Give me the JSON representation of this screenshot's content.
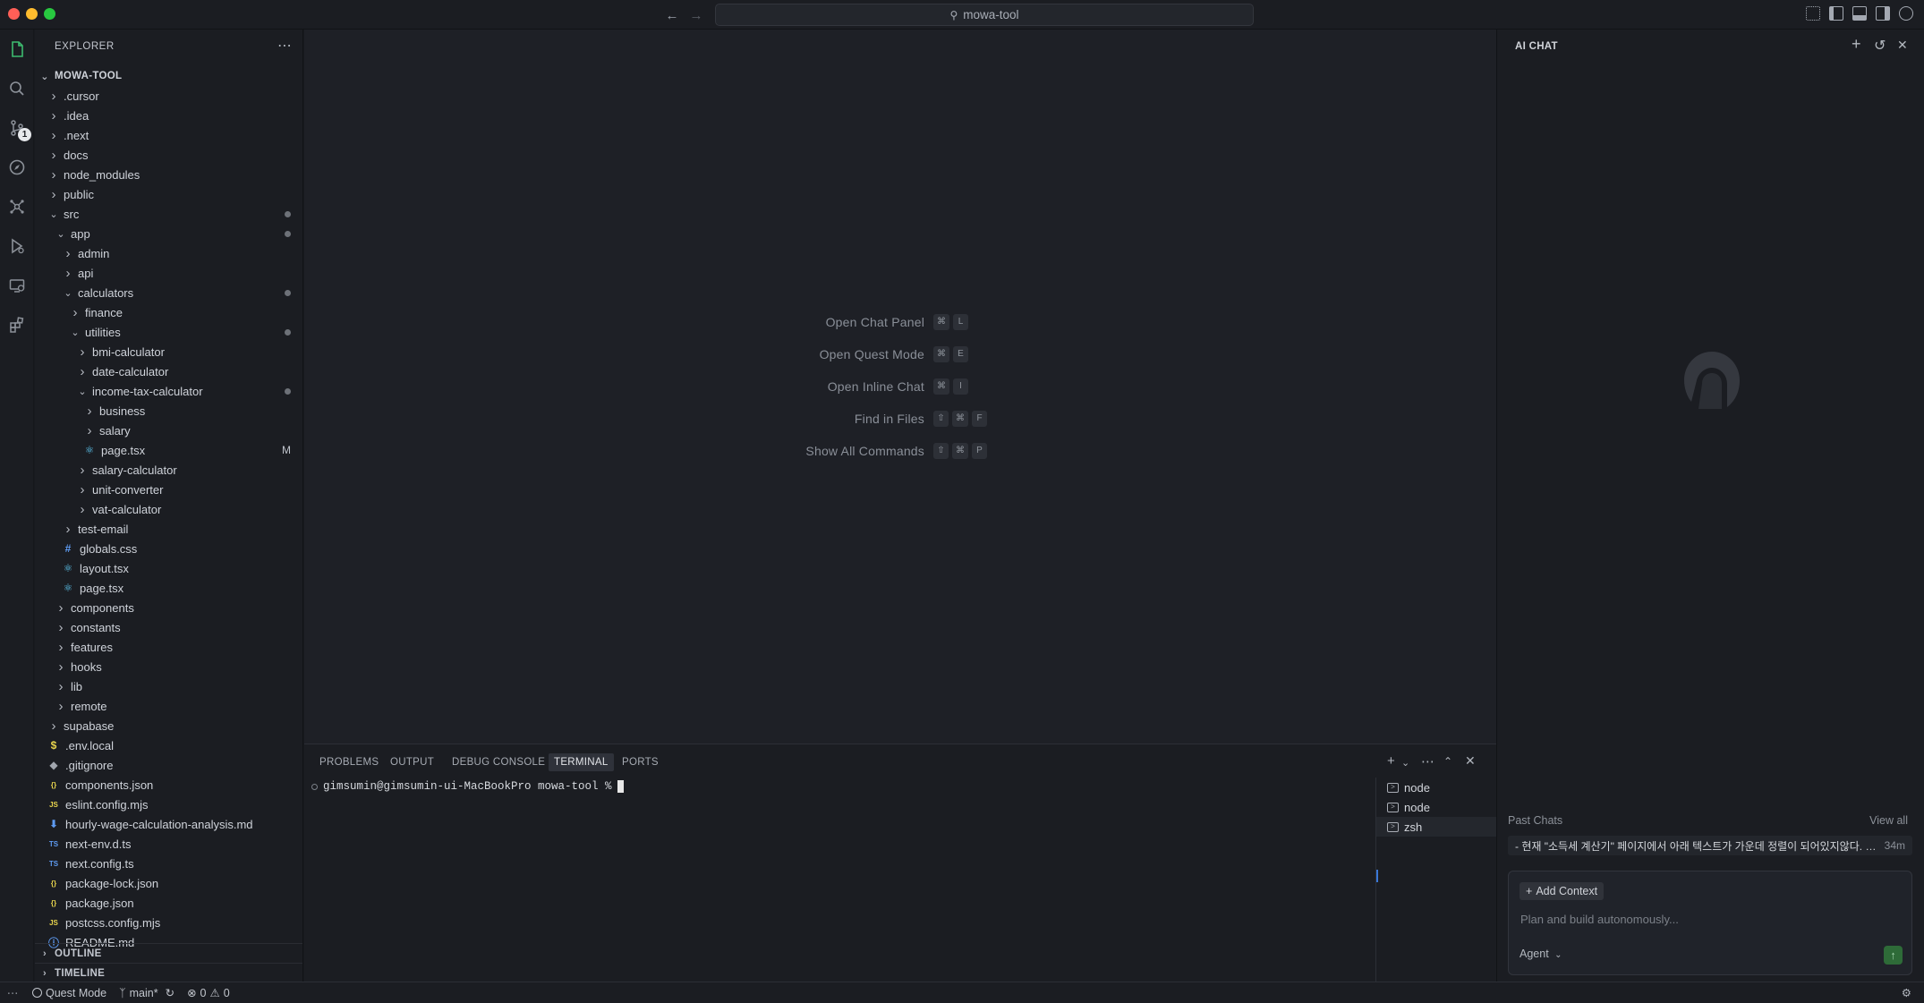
{
  "window": {
    "search_text": "mowa-tool"
  },
  "activity_bar": {
    "scm_badge": "1"
  },
  "explorer": {
    "title": "EXPLORER",
    "root": "MOWA-TOOL",
    "items": [
      {
        "label": ".cursor",
        "depth": 0,
        "type": "folder",
        "open": false
      },
      {
        "label": ".idea",
        "depth": 0,
        "type": "folder",
        "open": false
      },
      {
        "label": ".next",
        "depth": 0,
        "type": "folder",
        "open": false
      },
      {
        "label": "docs",
        "depth": 0,
        "type": "folder",
        "open": false
      },
      {
        "label": "node_modules",
        "depth": 0,
        "type": "folder",
        "open": false
      },
      {
        "label": "public",
        "depth": 0,
        "type": "folder",
        "open": false
      },
      {
        "label": "src",
        "depth": 0,
        "type": "folder",
        "open": true,
        "dot": true
      },
      {
        "label": "app",
        "depth": 1,
        "type": "folder",
        "open": true,
        "dot": true
      },
      {
        "label": "admin",
        "depth": 2,
        "type": "folder",
        "open": false
      },
      {
        "label": "api",
        "depth": 2,
        "type": "folder",
        "open": false
      },
      {
        "label": "calculators",
        "depth": 2,
        "type": "folder",
        "open": true,
        "dot": true
      },
      {
        "label": "finance",
        "depth": 3,
        "type": "folder",
        "open": false
      },
      {
        "label": "utilities",
        "depth": 3,
        "type": "folder",
        "open": true,
        "dot": true
      },
      {
        "label": "bmi-calculator",
        "depth": 4,
        "type": "folder",
        "open": false
      },
      {
        "label": "date-calculator",
        "depth": 4,
        "type": "folder",
        "open": false
      },
      {
        "label": "income-tax-calculator",
        "depth": 4,
        "type": "folder",
        "open": true,
        "dot": true
      },
      {
        "label": "business",
        "depth": 5,
        "type": "folder",
        "open": false
      },
      {
        "label": "salary",
        "depth": 5,
        "type": "folder",
        "open": false
      },
      {
        "label": "page.tsx",
        "depth": 5,
        "type": "react",
        "mark": "M"
      },
      {
        "label": "salary-calculator",
        "depth": 4,
        "type": "folder",
        "open": false
      },
      {
        "label": "unit-converter",
        "depth": 4,
        "type": "folder",
        "open": false
      },
      {
        "label": "vat-calculator",
        "depth": 4,
        "type": "folder",
        "open": false
      },
      {
        "label": "test-email",
        "depth": 2,
        "type": "folder",
        "open": false
      },
      {
        "label": "globals.css",
        "depth": 2,
        "type": "css"
      },
      {
        "label": "layout.tsx",
        "depth": 2,
        "type": "react"
      },
      {
        "label": "page.tsx",
        "depth": 2,
        "type": "react"
      },
      {
        "label": "components",
        "depth": 1,
        "type": "folder",
        "open": false
      },
      {
        "label": "constants",
        "depth": 1,
        "type": "folder",
        "open": false
      },
      {
        "label": "features",
        "depth": 1,
        "type": "folder",
        "open": false
      },
      {
        "label": "hooks",
        "depth": 1,
        "type": "folder",
        "open": false
      },
      {
        "label": "lib",
        "depth": 1,
        "type": "folder",
        "open": false
      },
      {
        "label": "remote",
        "depth": 1,
        "type": "folder",
        "open": false
      },
      {
        "label": "supabase",
        "depth": 0,
        "type": "folder",
        "open": false
      },
      {
        "label": ".env.local",
        "depth": 0,
        "type": "env"
      },
      {
        "label": ".gitignore",
        "depth": 0,
        "type": "git"
      },
      {
        "label": "components.json",
        "depth": 0,
        "type": "json"
      },
      {
        "label": "eslint.config.mjs",
        "depth": 0,
        "type": "js"
      },
      {
        "label": "hourly-wage-calculation-analysis.md",
        "depth": 0,
        "type": "md"
      },
      {
        "label": "next-env.d.ts",
        "depth": 0,
        "type": "ts"
      },
      {
        "label": "next.config.ts",
        "depth": 0,
        "type": "ts"
      },
      {
        "label": "package-lock.json",
        "depth": 0,
        "type": "json"
      },
      {
        "label": "package.json",
        "depth": 0,
        "type": "json"
      },
      {
        "label": "postcss.config.mjs",
        "depth": 0,
        "type": "js"
      },
      {
        "label": "README.md",
        "depth": 0,
        "type": "info"
      }
    ],
    "outline_label": "OUTLINE",
    "timeline_label": "TIMELINE"
  },
  "editor": {
    "shortcuts": [
      {
        "label": "Open Chat Panel",
        "keys": [
          "⌘",
          "L"
        ]
      },
      {
        "label": "Open Quest Mode",
        "keys": [
          "⌘",
          "E"
        ]
      },
      {
        "label": "Open Inline Chat",
        "keys": [
          "⌘",
          "I"
        ]
      },
      {
        "label": "Find in Files",
        "keys": [
          "⇧",
          "⌘",
          "F"
        ]
      },
      {
        "label": "Show All Commands",
        "keys": [
          "⇧",
          "⌘",
          "P"
        ]
      }
    ]
  },
  "panel": {
    "tabs": [
      "PROBLEMS",
      "OUTPUT",
      "DEBUG CONSOLE",
      "TERMINAL",
      "PORTS"
    ],
    "active_tab": "TERMINAL",
    "prompt": "gimsumin@gimsumin-ui-MacBookPro mowa-tool %",
    "terminals": [
      "node",
      "node",
      "zsh"
    ]
  },
  "ai_chat": {
    "title": "AI CHAT",
    "past_chats_label": "Past Chats",
    "view_all": "View all",
    "past_chat_text": "- 현재 \"소득세 계산기\" 페이지에서 아래 텍스트가 가운데 정렬이 되어있지않다. -...",
    "past_chat_time": "34m",
    "add_context": "Add Context",
    "placeholder": "Plan and build autonomously...",
    "agent_label": "Agent"
  },
  "status_bar": {
    "mode": "Quest Mode",
    "branch": "main*",
    "errors": "0",
    "warnings": "0"
  },
  "colors": {
    "accent": "#3a78d8",
    "send": "#2e6b38"
  }
}
